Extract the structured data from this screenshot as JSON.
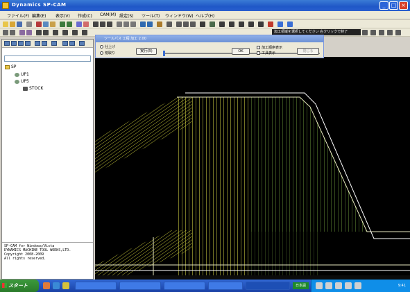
{
  "window": {
    "title": "Dynamics SP-CAM"
  },
  "menubar": {
    "items": [
      "ファイル(F)",
      "編集(E)",
      "表示(V)",
      "作成(C)",
      "CAM(M)",
      "設定(S)",
      "ツール(T)",
      "ウィンドウ(W)",
      "ヘルプ(H)"
    ]
  },
  "highlight_bar": {
    "text": "加工領域を選択してください 右クリックで終了"
  },
  "dialog": {
    "title": "ツールパス 工程 加工 2.00",
    "radio1": "仕上げ",
    "radio2": "荒取り",
    "button1": "実行(R)",
    "button2": "OK",
    "button3": "閉じる",
    "checkbox1": "加工順序表示",
    "checkbox2": "工具表示"
  },
  "tree": {
    "root": "SP",
    "child1": "UP1",
    "child2": "UP5",
    "leaf": "STOCK"
  },
  "console": {
    "lines": [
      "SP-CAM for Windows/Vista",
      "DYNAMICS MACHINE TOOL WORKS,LTD.",
      "Copyright 2008-2009",
      "All rights reserved."
    ]
  },
  "taskbar": {
    "start": "スタート",
    "lang": "日本語",
    "clock": "9:41"
  },
  "colors": {
    "titlebar": "#1f57c7",
    "canvas": "#000000",
    "toolpath": "#e6e64a",
    "stock_outline": "#ffffff"
  }
}
